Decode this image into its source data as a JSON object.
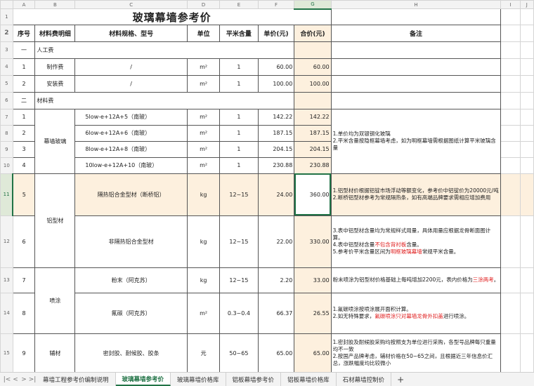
{
  "columns": [
    "A",
    "B",
    "C",
    "D",
    "E",
    "F",
    "G",
    "H",
    "I",
    "J"
  ],
  "rows": [
    "1",
    "2",
    "3",
    "4",
    "5",
    "6",
    "7",
    "8",
    "9",
    "10",
    "11",
    "12",
    "13",
    "14",
    "15"
  ],
  "title": "玻璃幕墙参考价",
  "header": {
    "seq": "序号",
    "material": "材料费明细",
    "spec": "材料规格、型号",
    "unit": "单位",
    "qty": "平米含量",
    "price": "单价(元)",
    "total": "合价(元)",
    "note": "备注"
  },
  "sections": {
    "labor": {
      "seq": "一",
      "name": "人工费"
    },
    "material": {
      "seq": "二",
      "name": "材料费"
    }
  },
  "groups": {
    "glass": "幕墙玻璃",
    "alu": "铝型材",
    "spray": "喷涂",
    "aux": "辅材"
  },
  "labor_rows": [
    {
      "seq": "1",
      "name": "制作费",
      "spec": "/",
      "unit": "m²",
      "qty": "1",
      "price": "60.00",
      "total": "60.00"
    },
    {
      "seq": "2",
      "name": "安装费",
      "spec": "/",
      "unit": "m²",
      "qty": "1",
      "price": "100.00",
      "total": "100.00"
    }
  ],
  "glass_rows": [
    {
      "seq": "1",
      "spec": "5low-e+12A+5（南玻）",
      "unit": "m²",
      "qty": "1",
      "price": "142.22",
      "total": "142.22"
    },
    {
      "seq": "2",
      "spec": "6low-e+12A+6（南玻）",
      "unit": "m²",
      "qty": "1",
      "price": "187.15",
      "total": "187.15"
    },
    {
      "seq": "3",
      "spec": "8low-e+12A+8（南玻）",
      "unit": "m²",
      "qty": "1",
      "price": "204.15",
      "total": "204.15"
    },
    {
      "seq": "4",
      "spec": "10low-e+12A+10（南玻）",
      "unit": "m²",
      "qty": "1",
      "price": "230.88",
      "total": "230.88"
    }
  ],
  "glass_note": "1.单价均为双银钢化玻璃\n2.平米含量按隐框幕墙考虑，如为明框幕墙需根据图纸计算平米玻璃含量",
  "alu_rows": [
    {
      "seq": "5",
      "spec": "隔热铝合金型材（断桥铝）",
      "unit": "kg",
      "qty": "12~15",
      "price": "24.00",
      "total": "360.00"
    },
    {
      "seq": "6",
      "spec": "非隔热铝合金型材",
      "unit": "kg",
      "qty": "12~15",
      "price": "22.00",
      "total": "330.00"
    }
  ],
  "alu_note5": "1.铝型材价根据铝锭市场浮动等额变化，参考价中铝锭价为20000元/吨\n2.断桥铝型材参考为常规隔热条，如有高端品牌要求需相应增加费用",
  "alu_note6_a": "3.表中铝型材含量均为常规样式用量，具体用量应根据龙骨断面图计算。\n4.表中铝型材含量",
  "alu_note6_red1": "不包含背衬板",
  "alu_note6_b": "含量。\n5.参考价平米含量区间为",
  "alu_note6_red2": "明框玻璃幕墙",
  "alu_note6_c": "常规平米含量。",
  "spray_rows": [
    {
      "seq": "7",
      "spec": "粉末（阿克苏）",
      "unit": "kg",
      "qty": "12~15",
      "price": "2.20",
      "total": "33.00"
    },
    {
      "seq": "8",
      "spec": "氟碳（阿克苏）",
      "unit": "m²",
      "qty": "0.3~0.4",
      "price": "66.37",
      "total": "26.55"
    }
  ],
  "spray_note7_a": "粉末喷涂为铝型材价格基础上每吨增加2200元，表内价格为",
  "spray_note7_red": "三涂两考",
  "spray_note7_b": "。",
  "spray_note8_a": "1.氟碳喷涂按喷涂展开面积计算。\n2.如无特殊要求，",
  "spray_note8_red": "氟碳喷涂只对幕墙龙骨外扣盖",
  "spray_note8_b": "进行喷涂。",
  "aux_rows": [
    {
      "seq": "9",
      "spec": "密封胶、耐候胶、胶条",
      "unit": "元",
      "qty": "50~65",
      "price": "65.00",
      "total": "65.00"
    }
  ],
  "aux_note": "1.密封胶及耐候胶采购均按照支为单位进行采购，各型号品牌每只重量均不一致\n2.按国产品牌考虑，辅材价格在50~65之间，且根据近三年信息价汇总，涨跌幅度均比较微小",
  "tabs": [
    "幕墙工程参考价编制说明",
    "玻璃幕墙参考价",
    "玻璃幕墙价格库",
    "铝板幕墙参考价",
    "铝板幕墙价格库",
    "石材幕墙控制价"
  ],
  "active_tab": "玻璃幕墙参考价"
}
